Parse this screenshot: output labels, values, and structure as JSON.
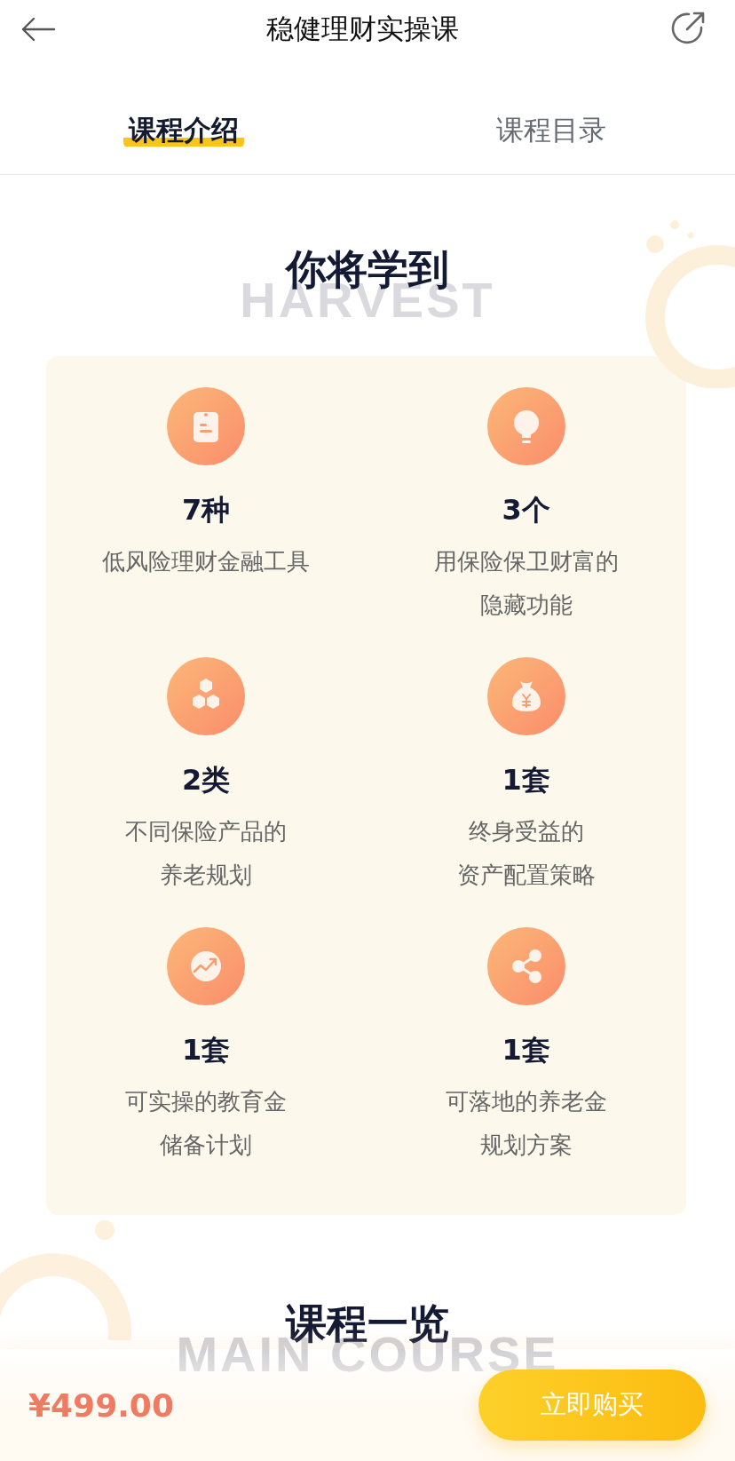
{
  "header": {
    "title": "稳健理财实操课"
  },
  "tabs": [
    {
      "label": "课程介绍",
      "selected": true
    },
    {
      "label": "课程目录",
      "selected": false
    }
  ],
  "learn_section": {
    "title": "你将学到",
    "watermark": "HARVEST",
    "items": [
      {
        "kind": "clipboard",
        "count": "7种",
        "description": [
          "低风险理财金融工具"
        ]
      },
      {
        "kind": "bulb",
        "count": "3个",
        "description": [
          "用保险保卫财富的",
          "隐藏功能"
        ]
      },
      {
        "kind": "cubes",
        "count": "2类",
        "description": [
          "不同保险产品的",
          "养老规划"
        ]
      },
      {
        "kind": "money-bag",
        "count": "1套",
        "description": [
          "终身受益的",
          "资产配置策略"
        ]
      },
      {
        "kind": "trend",
        "count": "1套",
        "description": [
          "可实操的教育金",
          "储备计划"
        ]
      },
      {
        "kind": "share",
        "count": "1套",
        "description": [
          "可落地的养老金",
          "规划方案"
        ]
      }
    ]
  },
  "overview_section": {
    "title": "课程一览",
    "watermark": "MAIN COURSE"
  },
  "bottom_bar": {
    "price": "¥499.00",
    "buy_button": "立即购买"
  }
}
